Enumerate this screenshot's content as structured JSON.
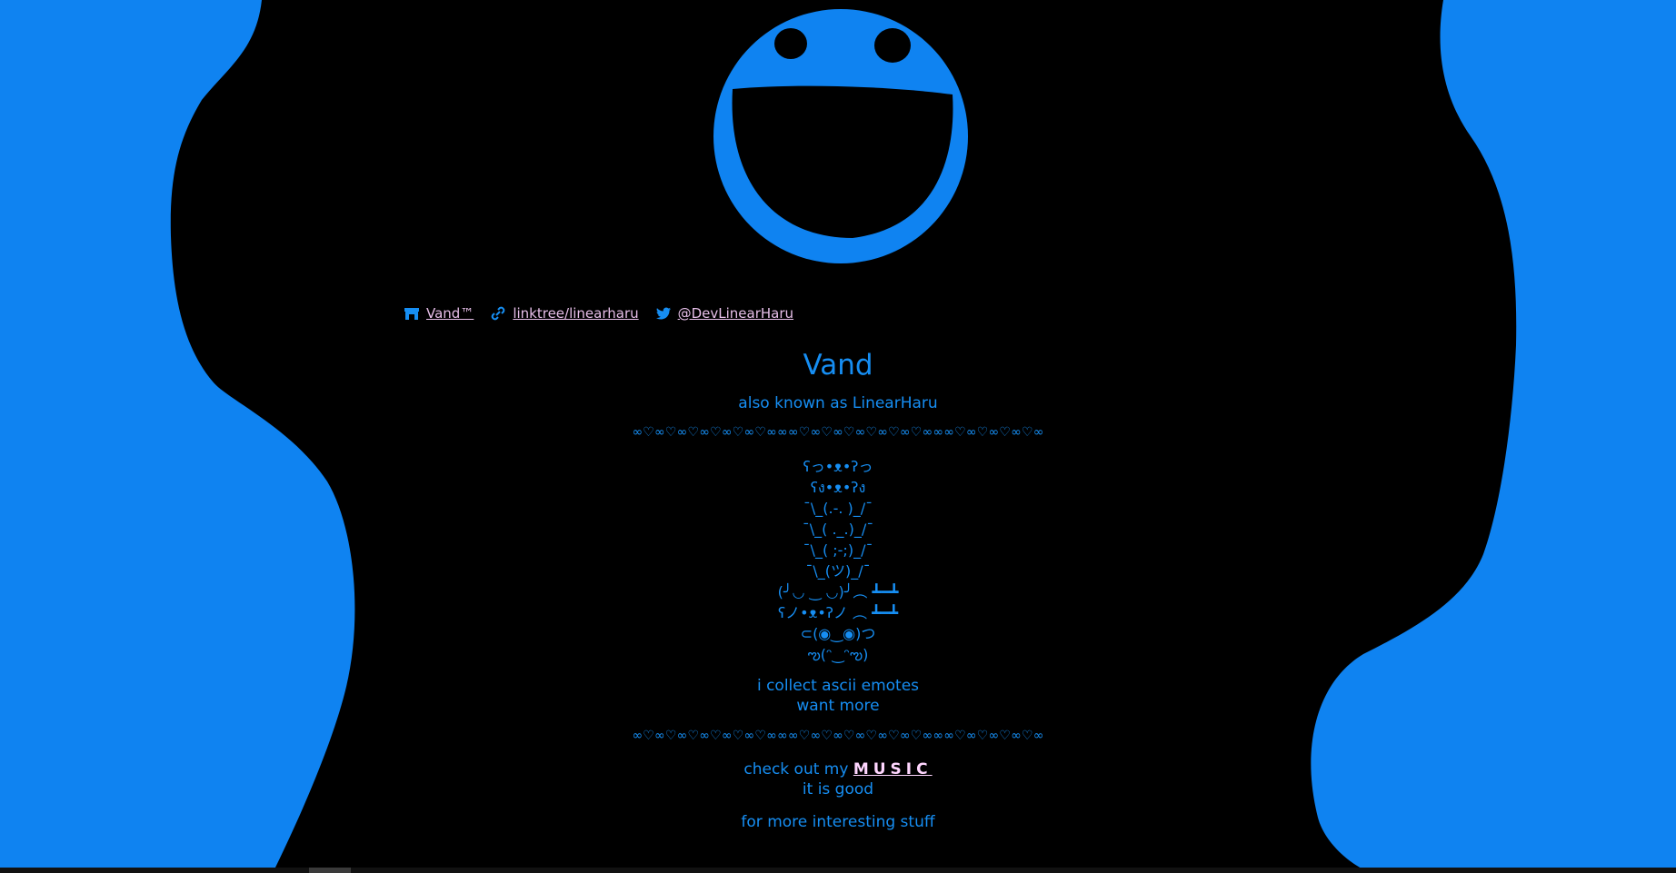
{
  "colors": {
    "page_background": "#0f83f1",
    "blob": "#000000",
    "accent_blue": "#168ef3",
    "link_pink": "#e7bfe9"
  },
  "links": [
    {
      "icon": "itch-store-icon",
      "label": "Vand™"
    },
    {
      "icon": "link-icon",
      "label": "linktree/linearharu"
    },
    {
      "icon": "twitter-bird-icon",
      "label": "@DevLinearHaru"
    }
  ],
  "profile": {
    "title": "Vand",
    "subtitle": "also known as LinearHaru",
    "divider": "∞♡∞♡∞♡∞♡∞♡∞♡∞∞∞♡∞♡∞♡∞♡∞♡∞♡∞∞∞♡∞♡∞♡∞♡∞"
  },
  "emotes": [
    "ʕっ•ᴥ•ʔっ",
    "ʕง•ᴥ•ʔง",
    "¯\\_(.-. )_/¯",
    "¯\\_( ._.)_/¯",
    "¯\\_( ;-;)_/¯",
    "¯\\_(ツ)_/¯",
    "(╯◡ ‿ ◡)╯︵ ┻━┻",
    "ʕノ•ᴥ•ʔノ ︵ ┻━┻",
    "⊂(◉‿◉)つ",
    "ఌ(ᵔ‿ᵔఌ)"
  ],
  "collect": {
    "line1": "i collect ascii emotes",
    "line2": "want more"
  },
  "music": {
    "prefix": "check out my ",
    "link_label": "MUSIC",
    "line2": "it is good"
  },
  "footer": {
    "line1": "for more interesting stuff"
  }
}
